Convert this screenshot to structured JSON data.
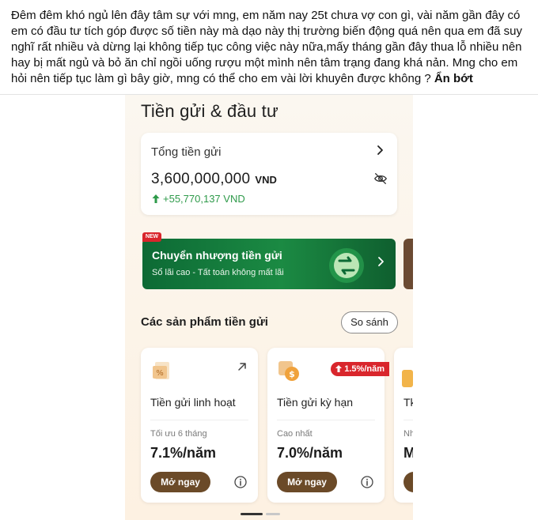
{
  "post": {
    "text": "Đêm đêm khó ngủ lên đây tâm sự với mng, em năm nay 25t chưa vợ con gì, vài năm gần đây có em có đầu tư tích góp được số tiền này mà dạo này thị trường biến động quá nên qua em đã suy nghĩ rất nhiều và dừng lại không tiếp tục công việc này nữa,mấy tháng gần đây thua lỗ nhiều nên hay bị mất ngủ và bỏ ăn chỉ ngồi uống rượu một mình nên tâm trạng đang khá nản. Mng cho em hỏi nên tiếp tục làm gì bây giờ, mng có thể cho em vài lời khuyên được không ?",
    "collapse_label": "Ẩn bớt"
  },
  "screen": {
    "title": "Tiền gửi & đầu tư",
    "total": {
      "label": "Tổng tiền gửi",
      "amount": "3,600,000,000",
      "currency": "VND",
      "change": "+55,770,137  VND"
    },
    "banner": {
      "badge": "NEW",
      "title": "Chuyển nhượng tiền gửi",
      "subtitle": "Sổ lãi cao - Tất toán không mất lãi"
    },
    "products": {
      "title": "Các sản phẩm tiền gửi",
      "compare_label": "So sánh",
      "items": [
        {
          "name": "Tiền gửi linh hoạt",
          "caption": "Tối ưu 6 tháng",
          "rate": "7.1%/năm",
          "button": "Mở ngay"
        },
        {
          "name": "Tiền gửi kỳ hạn",
          "badge": "1.5%/năm",
          "caption": "Cao nhất",
          "rate": "7.0%/năm",
          "button": "Mở ngay"
        }
      ],
      "peek": {
        "name": "Tk",
        "caption": "Nh",
        "rate": "M"
      }
    }
  },
  "colors": {
    "accent_brown": "#6b4a28",
    "positive_green": "#2e9a4a",
    "badge_red": "#d9262c",
    "banner_green": "#1b8a43"
  }
}
